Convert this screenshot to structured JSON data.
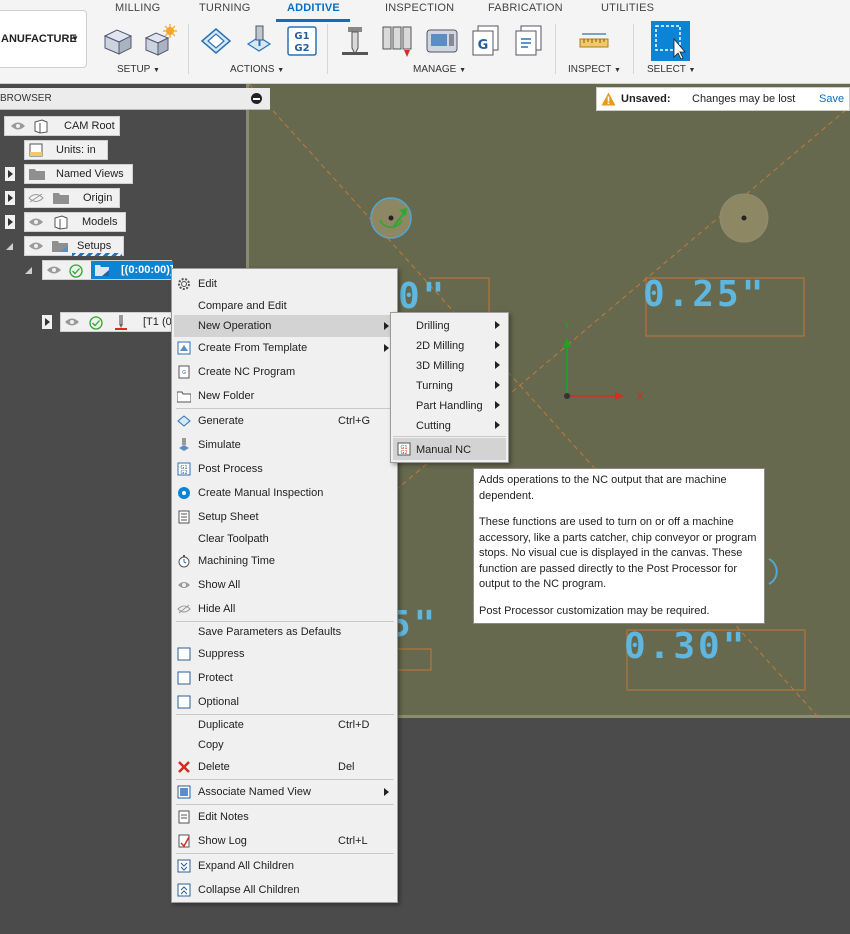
{
  "toolbar": {
    "workspace": "MANUFACTURE",
    "workspace_visible": "ANUFACTURE",
    "tabs": [
      "MILLING",
      "TURNING",
      "ADDITIVE",
      "INSPECTION",
      "FABRICATION",
      "UTILITIES"
    ],
    "active_tab": "ADDITIVE",
    "groups": [
      "SETUP",
      "ACTIONS",
      "MANAGE",
      "INSPECT",
      "SELECT"
    ],
    "accent": "#0a6fc2"
  },
  "browser": {
    "title": "BROWSER",
    "items": [
      {
        "label": "CAM Root"
      },
      {
        "label": "Units: in"
      },
      {
        "label": "Named Views"
      },
      {
        "label": "Origin"
      },
      {
        "label": "Models"
      },
      {
        "label": "Setups"
      },
      {
        "label": "[(0:00:00)]"
      },
      {
        "label": "[T1 (0"
      }
    ]
  },
  "canvas": {
    "dims": [
      "0\"",
      "0.25\"",
      "5\"",
      "0.30\""
    ],
    "axis_y": "Y",
    "axis_x": "X",
    "unsaved_label": "Unsaved:",
    "unsaved_msg": "Changes may be lost",
    "save": "Save"
  },
  "context_menu": {
    "items": [
      {
        "label": "Edit",
        "icon": "gear-icon"
      },
      {
        "label": "Compare and Edit"
      },
      {
        "label": "New Operation",
        "submenu": true
      },
      {
        "label": "Create From Template",
        "icon": "template-icon",
        "submenu": true
      },
      {
        "label": "Create NC Program",
        "icon": "nc-program-icon"
      },
      {
        "label": "New Folder",
        "icon": "folder-icon"
      },
      {
        "label": "Generate",
        "icon": "generate-icon",
        "shortcut": "Ctrl+G"
      },
      {
        "label": "Simulate",
        "icon": "simulate-icon"
      },
      {
        "label": "Post Process",
        "icon": "g1g2-icon"
      },
      {
        "label": "Create Manual Inspection",
        "icon": "inspection-icon"
      },
      {
        "label": "Setup Sheet",
        "icon": "setup-sheet-icon"
      },
      {
        "label": "Clear Toolpath"
      },
      {
        "label": "Machining Time",
        "icon": "stopwatch-icon"
      },
      {
        "label": "Show All",
        "icon": "eye-icon"
      },
      {
        "label": "Hide All",
        "icon": "eye-off-icon"
      },
      {
        "label": "Save Parameters as Defaults"
      },
      {
        "label": "Suppress",
        "icon": "checkbox-icon"
      },
      {
        "label": "Protect",
        "icon": "checkbox-icon"
      },
      {
        "label": "Optional",
        "icon": "checkbox-icon"
      },
      {
        "label": "Duplicate",
        "shortcut": "Ctrl+D"
      },
      {
        "label": "Copy"
      },
      {
        "label": "Delete",
        "icon": "delete-icon",
        "shortcut": "Del"
      },
      {
        "label": "Associate Named View",
        "icon": "named-view-icon",
        "submenu": true
      },
      {
        "label": "Edit Notes",
        "icon": "notes-icon"
      },
      {
        "label": "Show Log",
        "icon": "log-icon",
        "shortcut": "Ctrl+L"
      },
      {
        "label": "Expand All Children",
        "icon": "expand-icon"
      },
      {
        "label": "Collapse All Children",
        "icon": "collapse-icon"
      }
    ]
  },
  "submenu": {
    "items": [
      "Drilling",
      "2D Milling",
      "3D Milling",
      "Turning",
      "Part Handling",
      "Cutting",
      "Manual NC"
    ]
  },
  "tooltip": {
    "p1": "Adds operations to the NC output that are machine dependent.",
    "p2": "These functions are used to turn on or off a machine accessory, like a parts catcher, chip conveyor or program stops. No visual cue is displayed in the canvas. These function are passed directly to the Post Processor for output to the NC program.",
    "p3": "Post Processor customization may be required."
  }
}
